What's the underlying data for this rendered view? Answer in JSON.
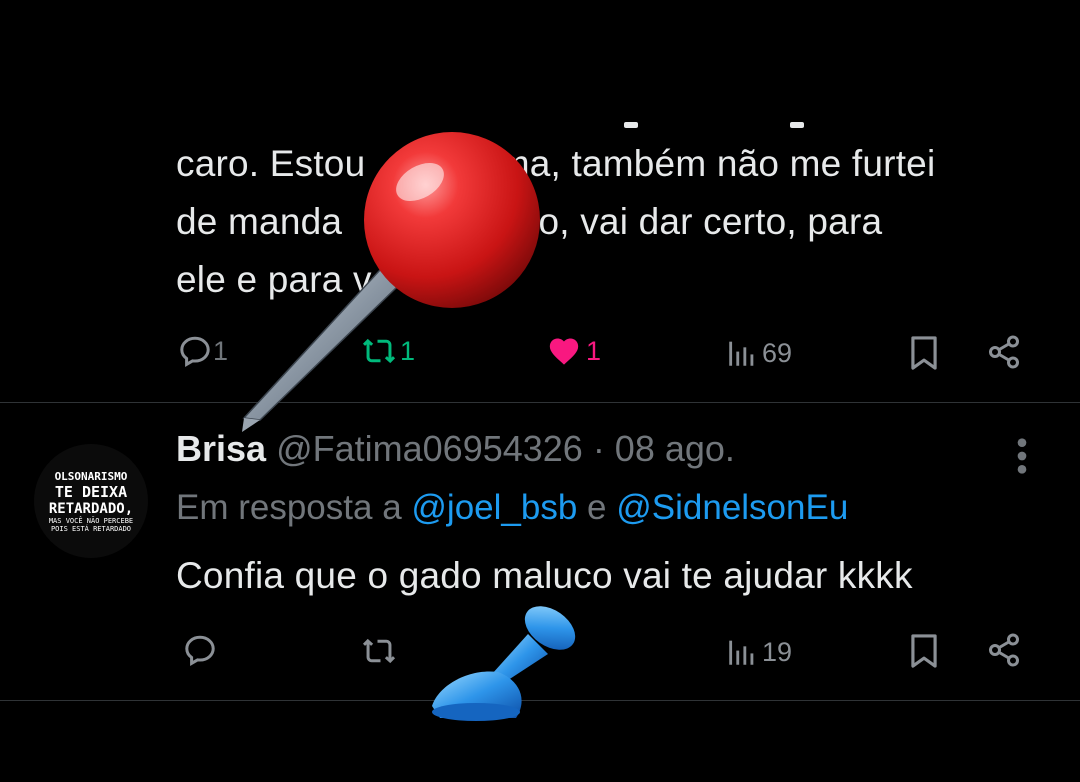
{
  "tweet1": {
    "lines": [
      "caro. Estou      mesma, também não me furtei",
      "de manda          quinho, vai dar certo, para",
      "ele e para v"
    ],
    "reply_count": "1",
    "retweet_count": "1",
    "like_count": "1",
    "views_count": "69"
  },
  "tweet2": {
    "name": "Brisa",
    "handle_date": "@Fatima06954326 · 08 ago.",
    "reply_prefix": "Em resposta a ",
    "mention1": "@joel_bsb",
    "reply_join": " e ",
    "mention2": "@SidnelsonEu",
    "text": "Confia que o gado maluco vai te ajudar kkkk",
    "views_count": "19",
    "avatar_lines": [
      "OLSONARISMO",
      "TE DEIXA",
      "RETARDADO,",
      "MAS VOCÊ NÃO PERCEBE",
      "POIS ESTÁ RETARDADO"
    ]
  },
  "colors": {
    "background": "#000000",
    "text": "#e7e9ea",
    "muted": "#71767b",
    "retweet_green": "#00ba7c",
    "like_pink": "#f91880",
    "link_blue": "#1d9bf0"
  },
  "icons": [
    "reply-icon",
    "retweet-icon",
    "like-icon",
    "views-icon",
    "bookmark-icon",
    "share-icon",
    "more-icon",
    "pushpin-sticker",
    "blue-pushpin-sticker"
  ]
}
